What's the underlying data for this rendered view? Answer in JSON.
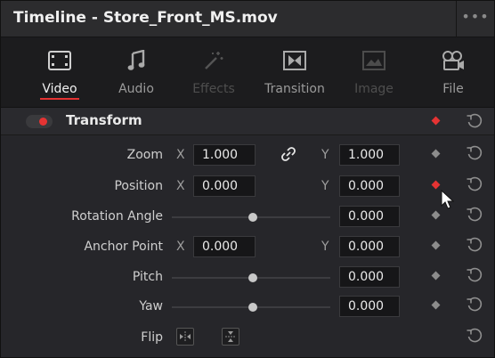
{
  "window": {
    "title": "Timeline - Store_Front_MS.mov",
    "menu_icon": "ellipsis-icon"
  },
  "tabs": [
    {
      "label": "Video",
      "icon": "film-icon",
      "state": "active"
    },
    {
      "label": "Audio",
      "icon": "music-note-icon",
      "state": "normal"
    },
    {
      "label": "Effects",
      "icon": "magic-wand-icon",
      "state": "disabled"
    },
    {
      "label": "Transition",
      "icon": "transition-icon",
      "state": "normal"
    },
    {
      "label": "Image",
      "icon": "image-icon",
      "state": "disabled"
    },
    {
      "label": "File",
      "icon": "film-reel-icon",
      "state": "normal"
    }
  ],
  "section": {
    "title": "Transform",
    "enabled": true
  },
  "params": {
    "zoom": {
      "label": "Zoom",
      "x_axis": "X",
      "x": "1.000",
      "y_axis": "Y",
      "y": "1.000",
      "linked": true
    },
    "position": {
      "label": "Position",
      "x_axis": "X",
      "x": "0.000",
      "y_axis": "Y",
      "y": "0.000",
      "keyframed": true
    },
    "rotation": {
      "label": "Rotation Angle",
      "value": "0.000"
    },
    "anchor": {
      "label": "Anchor Point",
      "x_axis": "X",
      "x": "0.000",
      "y_axis": "Y",
      "y": "0.000"
    },
    "pitch": {
      "label": "Pitch",
      "value": "0.000"
    },
    "yaw": {
      "label": "Yaw",
      "value": "0.000"
    },
    "flip": {
      "label": "Flip"
    }
  },
  "colors": {
    "accent": "#e53333",
    "panel": "#26262a",
    "field": "#161618"
  }
}
